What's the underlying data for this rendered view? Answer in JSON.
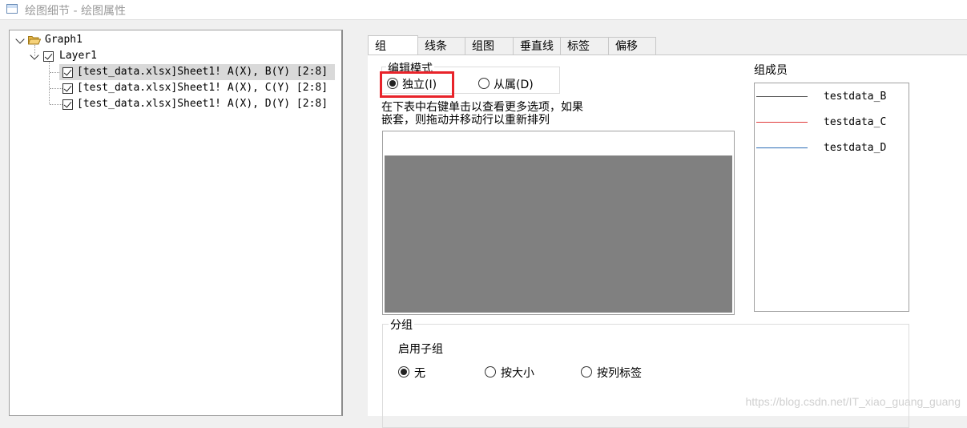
{
  "window": {
    "title": "绘图细节 - 绘图属性"
  },
  "tree": {
    "root": "Graph1",
    "layer": "Layer1",
    "plots": [
      "[test_data.xlsx]Sheet1! A(X), B(Y) [2:8]",
      "[test_data.xlsx]Sheet1! A(X), C(Y) [2:8]",
      "[test_data.xlsx]Sheet1! A(X), D(Y) [2:8]"
    ]
  },
  "tabs": [
    "组",
    "线条",
    "组图",
    "垂直线",
    "标签",
    "偏移"
  ],
  "edit_mode": {
    "label": "编辑模式",
    "independent": "独立(I)",
    "dependent": "从属(D)",
    "hint": [
      "在下表中右键单击以查看更多选项，如果",
      "嵌套，则拖动并移动行以重新排列"
    ]
  },
  "members": {
    "label": "组成员",
    "items": [
      {
        "name": "testdata_B",
        "color": "#555555"
      },
      {
        "name": "testdata_C",
        "color": "#e03c3c"
      },
      {
        "name": "testdata_D",
        "color": "#2a6bb5"
      }
    ]
  },
  "grouping": {
    "label": "分组",
    "subgroup_label": "启用子组",
    "options": [
      "无",
      "按大小",
      "按列标签"
    ]
  },
  "watermark": "https://blog.csdn.net/IT_xiao_guang_guang"
}
